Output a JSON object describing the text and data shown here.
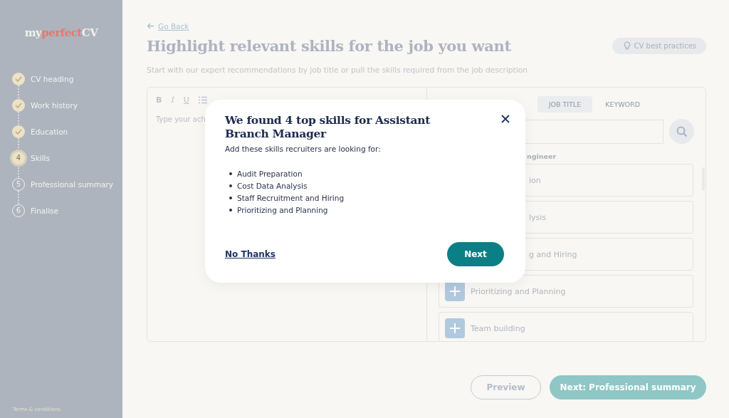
{
  "sidebar": {
    "logo": {
      "part_1": "my",
      "part_2": "perfect",
      "part_3": "CV"
    },
    "steps": [
      {
        "label": "CV heading",
        "completed": true,
        "current": false
      },
      {
        "label": "Work history",
        "completed": true,
        "current": false
      },
      {
        "label": "Education",
        "completed": true,
        "current": false
      },
      {
        "number": "4",
        "label": "Skills",
        "completed": false,
        "current": true
      },
      {
        "number": "5",
        "label": "Professional summary",
        "completed": false,
        "current": false
      },
      {
        "number": "6",
        "label": "Finalise",
        "completed": false,
        "current": false
      }
    ],
    "footer_links": [
      "Terms & conditions"
    ]
  },
  "header": {
    "back_link": "Go Back",
    "title": "Highlight relevant skills for the job you want",
    "subtitle": "Start with our expert recommendations by job title or pull the skills required from the job description",
    "tips_button": "CV best practices"
  },
  "editor": {
    "toolbar": [
      {
        "kind": "bold",
        "label": "B"
      },
      {
        "kind": "italic",
        "label": "I"
      },
      {
        "kind": "underline",
        "label": "U"
      },
      {
        "kind": "list"
      }
    ],
    "placeholder": "Type your ach"
  },
  "search_panel": {
    "tabs": [
      {
        "label": "JOB TITLE",
        "selected": true
      },
      {
        "label": "KEYWORD",
        "selected": false
      }
    ],
    "results_label": "ngineer",
    "skills": [
      {
        "label": "ion",
        "add_icon": false
      },
      {
        "label": "lysis",
        "add_icon": false
      },
      {
        "label": "g and Hiring",
        "add_icon": false
      },
      {
        "label": "Prioritizing and Planning",
        "add_icon": true
      },
      {
        "label": "Team building",
        "add_icon": true
      }
    ]
  },
  "footer": {
    "preview_button": "Preview",
    "next_button": "Next: Professional summary"
  },
  "modal": {
    "title": "We found 4 top skills for Assistant Branch Manager",
    "text": "Add these skills recruiters are looking for:",
    "skills": [
      "Audit Preparation",
      "Cost Data Analysis",
      "Staff Recruitment and Hiring",
      "Prioritizing and Planning"
    ],
    "dismiss_link": "No Thanks",
    "next_button": "Next"
  }
}
